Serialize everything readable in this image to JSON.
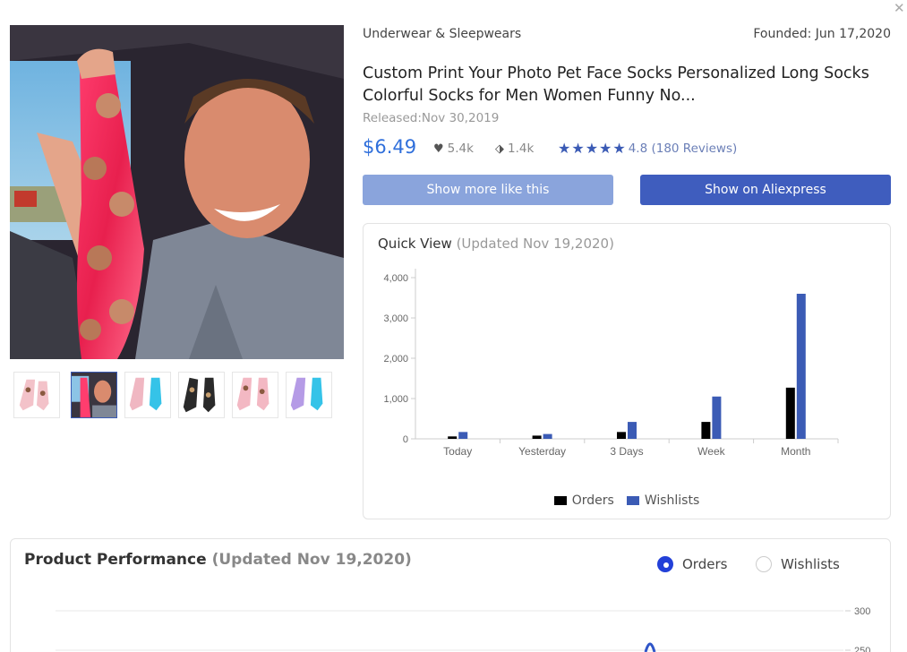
{
  "header": {
    "category": "Underwear & Sleepwears",
    "founded": "Founded: Jun 17,2020",
    "close_icon": "close-icon"
  },
  "product": {
    "title": "Custom Print Your Photo Pet Face Socks Personalized Long Socks Colorful Socks for Men Women Funny No...",
    "released": "Released:Nov 30,2019",
    "price": "$6.49",
    "likes": "5.4k",
    "tags": "1.4k",
    "rating": "4.8 (180 Reviews)",
    "stars": 4.8
  },
  "buttons": {
    "show_more": "Show more like this",
    "show_on": "Show on Aliexpress"
  },
  "quick_view": {
    "title": "Quick View",
    "updated": "(Updated Nov 19,2020)"
  },
  "chart_data": {
    "type": "bar",
    "categories": [
      "Today",
      "Yesterday",
      "3 Days",
      "Week",
      "Month"
    ],
    "series": [
      {
        "name": "Orders",
        "color": "#000000",
        "values": [
          60,
          80,
          170,
          420,
          1270
        ]
      },
      {
        "name": "Wishlists",
        "color": "#3b5bb5",
        "values": [
          170,
          120,
          420,
          1050,
          3600
        ]
      }
    ],
    "yticks": [
      "0",
      "1,000",
      "2,000",
      "3,000",
      "4,000"
    ],
    "ylim": [
      0,
      4000
    ],
    "legend": "bottom"
  },
  "performance": {
    "title": "Product Performance",
    "updated": "(Updated Nov 19,2020)",
    "options": [
      "Orders",
      "Wishlists"
    ],
    "selected": "Orders",
    "yticks": [
      "300",
      "250"
    ]
  },
  "colors": {
    "accent": "#3f5dbe",
    "accent_light": "#8aa4dc",
    "price": "#2f6fdb"
  }
}
